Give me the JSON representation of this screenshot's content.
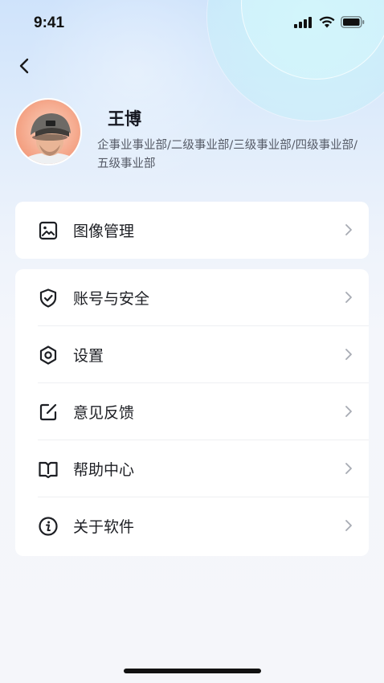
{
  "status_bar": {
    "time": "9:41"
  },
  "profile": {
    "name": "王博",
    "department": "企事业事业部/二级事业部/三级事业部/四级事业部/五级事业部"
  },
  "menu_group_1": [
    {
      "label": "图像管理",
      "icon": "image-icon"
    }
  ],
  "menu_group_2": [
    {
      "label": "账号与安全",
      "icon": "shield-check-icon"
    },
    {
      "label": "设置",
      "icon": "gear-icon"
    },
    {
      "label": "意见反馈",
      "icon": "edit-icon"
    },
    {
      "label": "帮助中心",
      "icon": "book-icon"
    },
    {
      "label": "关于软件",
      "icon": "info-icon"
    }
  ],
  "colors": {
    "background": "#f4f6fb",
    "card": "#ffffff",
    "text": "#1d1f24",
    "secondary_text": "#555a66",
    "chevron": "#a7abb3"
  }
}
